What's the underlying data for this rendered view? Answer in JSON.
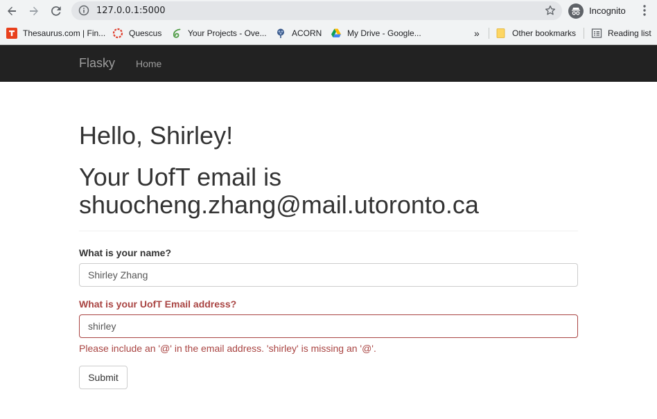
{
  "browser": {
    "url": "127.0.0.1:5000",
    "incognito_label": "Incognito",
    "bookmarks": [
      {
        "label": "Thesaurus.com | Fin...",
        "icon": "thesaurus-icon"
      },
      {
        "label": "Quescus",
        "icon": "quercus-icon"
      },
      {
        "label": "Your Projects - Ove...",
        "icon": "overleaf-icon"
      },
      {
        "label": "ACORN",
        "icon": "acorn-icon"
      },
      {
        "label": "My Drive - Google...",
        "icon": "google-drive-icon"
      }
    ],
    "overflow_label": "»",
    "other_bookmarks": "Other bookmarks",
    "reading_list": "Reading list"
  },
  "navbar": {
    "brand": "Flasky",
    "home": "Home",
    "background": "#222222"
  },
  "page": {
    "greeting": "Hello, Shirley!",
    "email_line": "Your UofT email is shuocheng.zhang@mail.utoronto.ca"
  },
  "form": {
    "name_label": "What is your name?",
    "name_value": "Shirley Zhang",
    "email_label": "What is your UofT Email address?",
    "email_value": "shirley",
    "error_message": "Please include an '@' in the email address. 'shirley' is missing an '@'.",
    "submit_label": "Submit",
    "error_color": "#a94442"
  }
}
